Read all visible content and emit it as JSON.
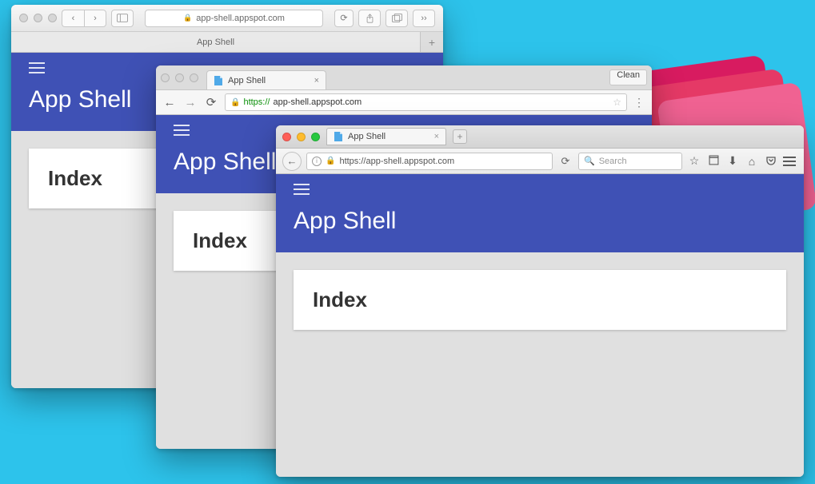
{
  "safari": {
    "traffic": "dim",
    "address": "app-shell.appspot.com",
    "tab_title": "App Shell",
    "app_title": "App Shell",
    "card_title": "Index"
  },
  "chrome": {
    "tab_title": "App Shell",
    "clean_label": "Clean",
    "protocol": "https://",
    "host": "app-shell.appspot.com",
    "app_title": "App Shell",
    "card_title": "Index"
  },
  "firefox": {
    "tab_title": "App Shell",
    "address": "https://app-shell.appspot.com",
    "search_placeholder": "Search",
    "app_title": "App Shell",
    "card_title": "Index"
  },
  "colors": {
    "background": "#2dc3eb",
    "app_header": "#3f51b5"
  }
}
